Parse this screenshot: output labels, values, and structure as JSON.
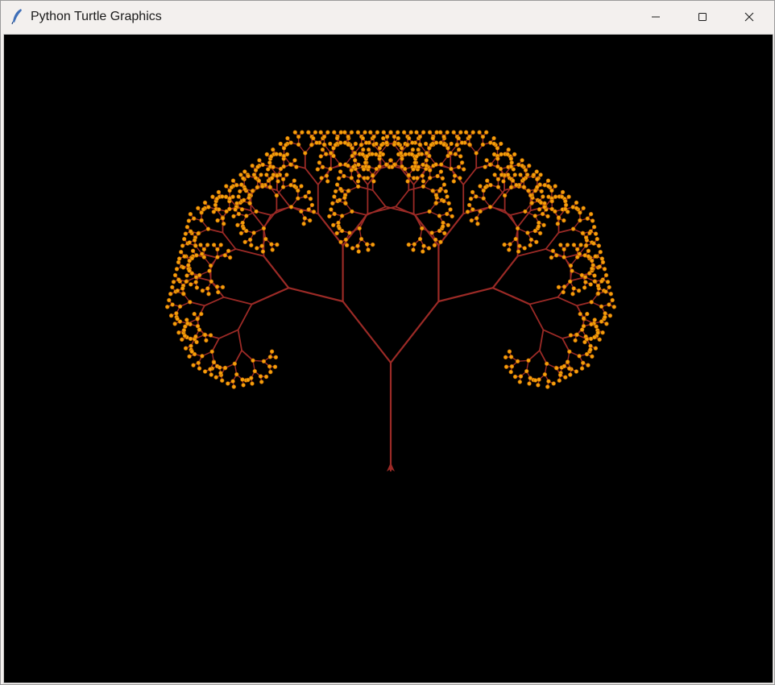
{
  "window": {
    "title": "Python Turtle Graphics",
    "icon": "feather-icon"
  },
  "controls": {
    "minimize": "minimize-icon",
    "maximize": "maximize-icon",
    "close": "close-icon"
  },
  "canvas": {
    "background": "#000000",
    "branch_color": "#9b2a26",
    "leaf_color": "#f5a10b",
    "turtle_color": "#9b2a26"
  }
}
